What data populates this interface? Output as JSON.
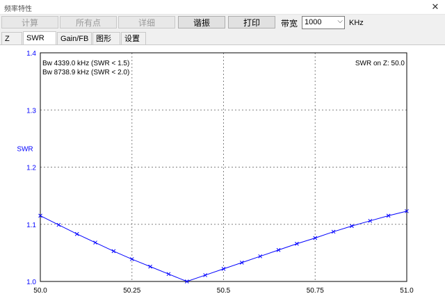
{
  "window": {
    "title": "频率特性",
    "close_glyph": "✕"
  },
  "toolbar": {
    "calculate_label": "计算",
    "all_points_label": "所有点",
    "details_label": "详细",
    "resonance_label": "谐振",
    "print_label": "打印",
    "bandwidth_label": "带宽",
    "bandwidth_value": "1000",
    "bandwidth_unit": "KHz"
  },
  "tabs": [
    {
      "label": "Z"
    },
    {
      "label": "SWR",
      "active": true
    },
    {
      "label": "Gain/FB"
    },
    {
      "label": "图形"
    },
    {
      "label": "设置"
    }
  ],
  "colors": {
    "curve": "#0000ff",
    "grid": "#808080"
  },
  "chart_data": {
    "type": "line",
    "ylabel": "SWR",
    "xlim": [
      50.0,
      51.0
    ],
    "ylim": [
      1.0,
      1.4
    ],
    "x_ticks": [
      "50.0",
      "50.25",
      "50.5",
      "50.75",
      "51.0"
    ],
    "y_ticks": [
      "1.0",
      "1.1",
      "1.2",
      "1.3",
      "1.4"
    ],
    "grid": true,
    "annotations": [
      "Bw 4339.0 kHz (SWR < 1.5)",
      "Bw 8738.9 kHz (SWR < 2.0)"
    ],
    "reference_note": "SWR on Z: 50.0",
    "series": [
      {
        "x": [
          50.0,
          50.05,
          50.1,
          50.15,
          50.2,
          50.25,
          50.3,
          50.35,
          50.4,
          50.45,
          50.5,
          50.55,
          50.6,
          50.65,
          50.7,
          50.75,
          50.8,
          50.85,
          50.9,
          50.95,
          51.0
        ],
        "values": [
          1.115,
          1.099,
          1.083,
          1.068,
          1.053,
          1.039,
          1.026,
          1.013,
          1.0,
          1.011,
          1.022,
          1.033,
          1.044,
          1.055,
          1.066,
          1.076,
          1.087,
          1.097,
          1.106,
          1.115,
          1.123
        ]
      }
    ]
  }
}
